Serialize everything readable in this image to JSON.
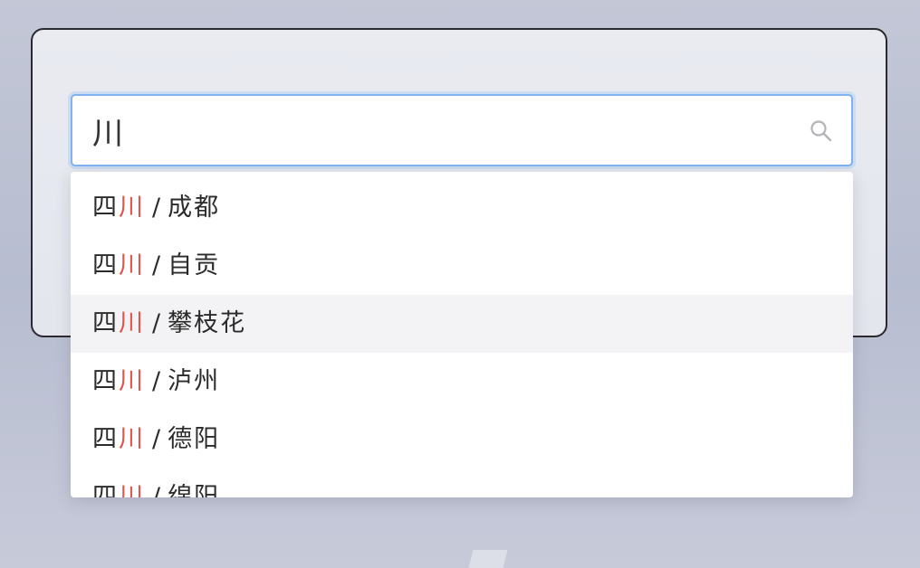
{
  "search": {
    "value": "川",
    "placeholder": ""
  },
  "suggestions": [
    {
      "prefix": "四",
      "match": "川",
      "separator": "/",
      "city": "成都",
      "highlighted": false
    },
    {
      "prefix": "四",
      "match": "川",
      "separator": "/",
      "city": "自贡",
      "highlighted": false
    },
    {
      "prefix": "四",
      "match": "川",
      "separator": "/",
      "city": "攀枝花",
      "highlighted": true
    },
    {
      "prefix": "四",
      "match": "川",
      "separator": "/",
      "city": "泸州",
      "highlighted": false
    },
    {
      "prefix": "四",
      "match": "川",
      "separator": "/",
      "city": "德阳",
      "highlighted": false
    },
    {
      "prefix": "四",
      "match": "川",
      "separator": "/",
      "city": "绵阳",
      "highlighted": false
    }
  ],
  "icons": {
    "search": "search-icon"
  },
  "colors": {
    "match_highlight": "#e5534b",
    "focus_border": "#7fb3f2",
    "row_hover": "#f3f3f5"
  }
}
